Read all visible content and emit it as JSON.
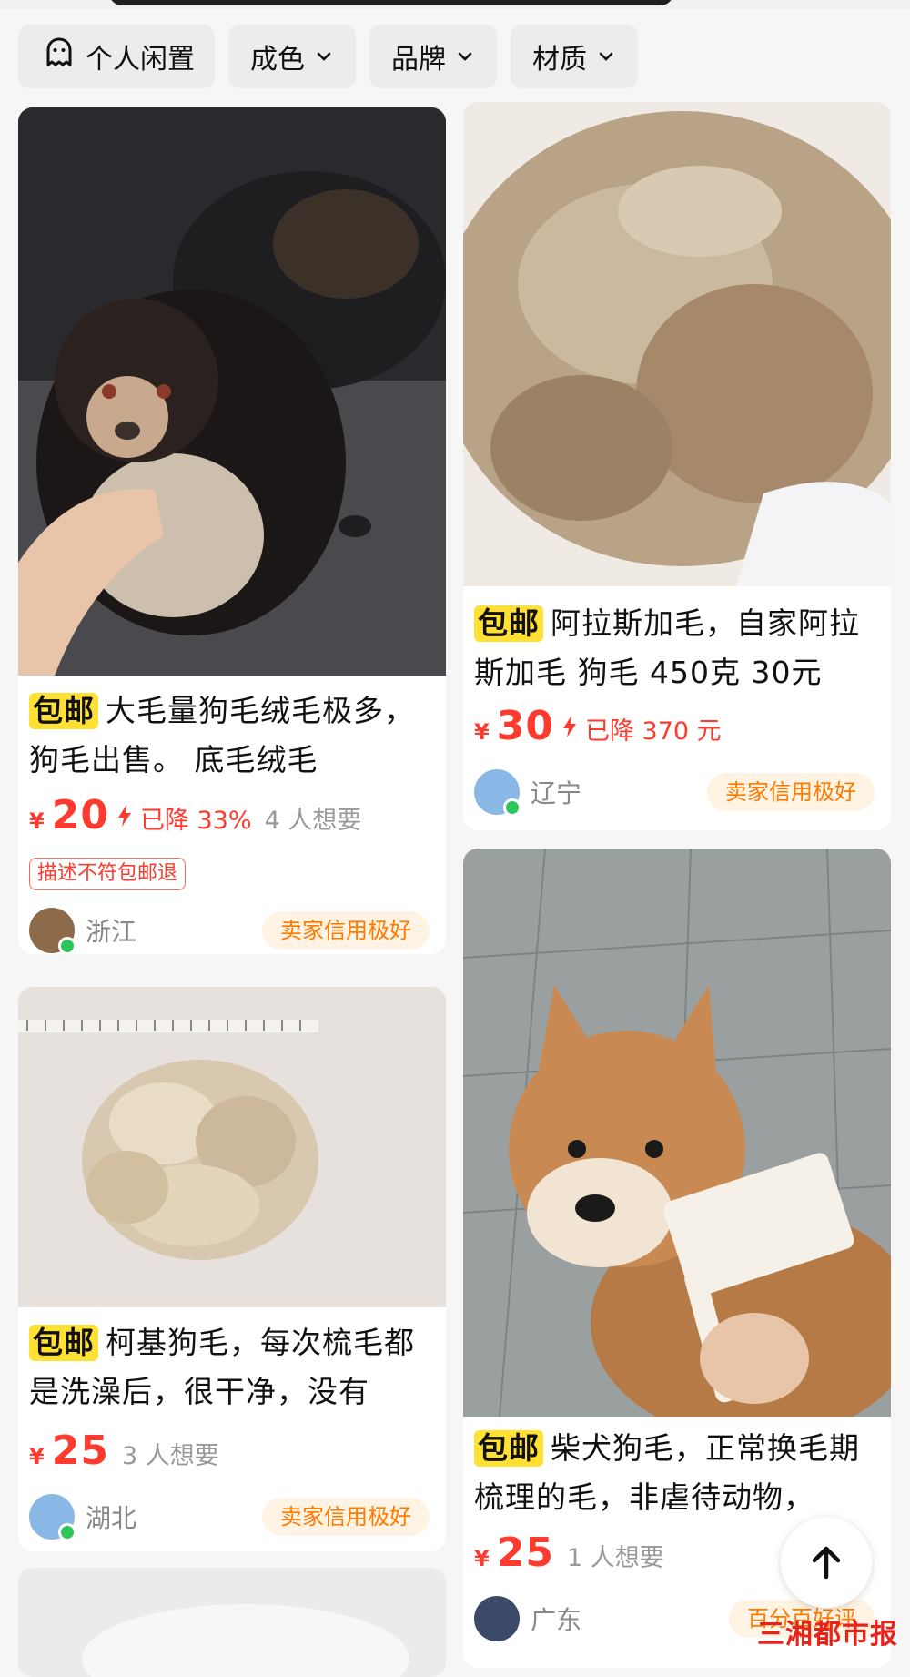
{
  "filters": [
    {
      "label": "个人闲置",
      "icon": "smiley-ghost-icon"
    },
    {
      "label": "成色",
      "icon": "chevron-down-icon"
    },
    {
      "label": "品牌",
      "icon": "chevron-down-icon"
    },
    {
      "label": "材质",
      "icon": "chevron-down-icon"
    }
  ],
  "cards": [
    {
      "badge": "包邮",
      "title": "大毛量狗毛绒毛极多，狗毛出售。 底毛绒毛",
      "currency": "¥",
      "price": "20",
      "price_drop": "已降 33%",
      "want": "4 人想要",
      "refund_tag": "描述不符包邮退",
      "location": "浙江",
      "credit": "卖家信用极好"
    },
    {
      "badge": "包邮",
      "title": "阿拉斯加毛，自家阿拉斯加毛 狗毛 450克 30元",
      "currency": "¥",
      "price": "30",
      "price_drop": "已降 370 元",
      "location": "辽宁",
      "credit": "卖家信用极好"
    },
    {
      "badge": "包邮",
      "title": "柯基狗毛，每次梳毛都是洗澡后，很干净，没有",
      "currency": "¥",
      "price": "25",
      "want": "3 人想要",
      "location": "湖北",
      "credit": "卖家信用极好"
    },
    {
      "badge": "包邮",
      "title": "柴犬狗毛，正常换毛期梳理的毛，非虐待动物，",
      "currency": "¥",
      "price": "25",
      "want": "1 人想要",
      "location": "广东",
      "credit": "百分百好评"
    }
  ],
  "fab": {
    "icon": "arrow-up-icon"
  },
  "watermark": "三湘都市报",
  "colors": {
    "price": "#ff3a2e",
    "badge": "#ffe033",
    "credit": "#ff7a00",
    "chip": "#ececec"
  }
}
